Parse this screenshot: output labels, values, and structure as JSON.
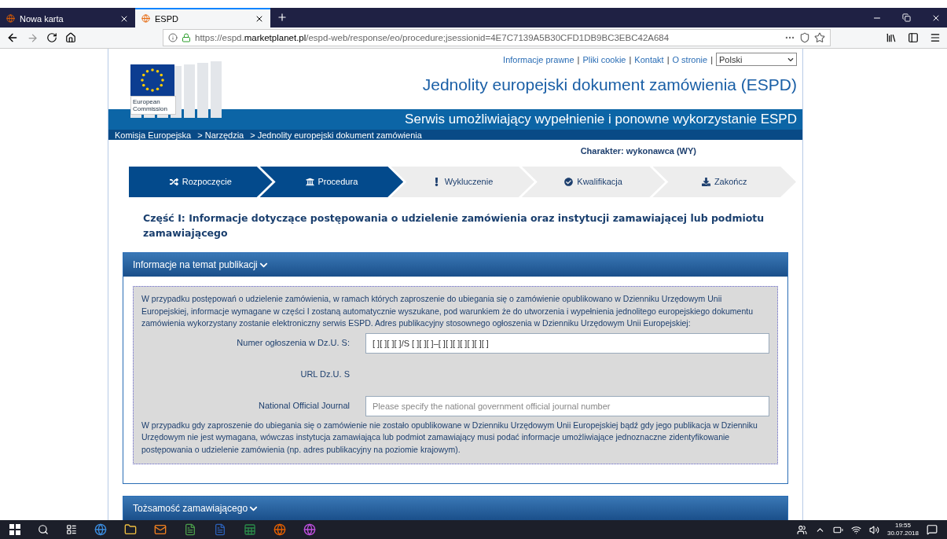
{
  "browser": {
    "tabs": [
      {
        "title": "Nowa karta",
        "selected": false
      },
      {
        "title": "ESPD",
        "selected": true
      }
    ],
    "url_host": "https://espd.",
    "url_domain": "marketplanet.pl",
    "url_path": "/espd-web/response/eo/procedure;jsessionid=4E7C7139A5B30CFD1DB9BC3EBC42A684"
  },
  "header": {
    "links": [
      "Informacje prawne",
      "Pliki cookie",
      "Kontakt",
      "O stronie"
    ],
    "separator": "|",
    "language": "Polski",
    "logo_text": "European Commission",
    "title": "Jednolity europejski dokument zamówienia (ESPD)",
    "subtitle": "Serwis umożliwiający wypełnienie i ponowne wykorzystanie ESPD",
    "breadcrumbs": [
      "Komisja Europejska",
      "> Narzędzia",
      "> Jednolity europejski dokument zamówienia"
    ]
  },
  "role": "Charakter: wykonawca (WY)",
  "steps": [
    {
      "label": "Rozpoczęcie",
      "kind": "shuffle",
      "completed": true
    },
    {
      "label": "Procedura",
      "kind": "bank",
      "completed": true
    },
    {
      "label": "Wykluczenie",
      "kind": "exclamation",
      "completed": false
    },
    {
      "label": "Kwalifikacja",
      "kind": "check",
      "completed": false
    },
    {
      "label": "Zakończ",
      "kind": "download",
      "completed": false
    }
  ],
  "section_title": "Część I: Informacje dotyczące postępowania o udzielenie zamówienia oraz instytucji zamawiającej lub podmiotu zamawiającego",
  "panels": [
    {
      "title": "Informacje na temat publikacji",
      "expanded": true,
      "intro": "W przypadku postępowań o udzielenie zamówienia, w ramach których zaproszenie do ubiegania się o zamówienie opublikowano w Dzienniku Urzędowym Unii Europejskiej, informacje wymagane w części I zostaną automatycznie wyszukane, pod warunkiem że do utworzenia i wypełnienia jednolitego europejskiego dokumentu zamówienia wykorzystany zostanie elektroniczny serwis ESPD. Adres publikacyjny stosownego ogłoszenia w Dzienniku Urzędowym Unii Europejskiej:",
      "fields": [
        {
          "label": "Numer ogłoszenia w Dz.U. S:",
          "kind": "input",
          "value": "[ ][ ][ ][ ]/S [ ][ ][ ]–[ ][ ][ ][ ][ ][ ][ ]"
        },
        {
          "label": "URL Dz.U. S",
          "kind": "text"
        },
        {
          "label": "National Official Journal",
          "kind": "input",
          "placeholder": "Please specify the national government official journal number"
        }
      ],
      "outro": "W przypadku gdy zaproszenie do ubiegania się o zamówienie nie zostało opublikowane w Dzienniku Urzędowym Unii Europejskiej bądź gdy jego publikacja w Dzienniku Urzędowym nie jest wymagana, wówczas instytucja zamawiająca lub podmiot zamawiający musi podać informacje umożliwiające jednoznaczne zidentyfikowanie postępowania o udzielenie zamówienia (np. adres publikacyjny na poziomie krajowym)."
    },
    {
      "title": "Tożsamość zamawiającego",
      "expanded": false
    }
  ],
  "taskbar": {
    "time": "19:55",
    "date": "30.07.2018"
  }
}
